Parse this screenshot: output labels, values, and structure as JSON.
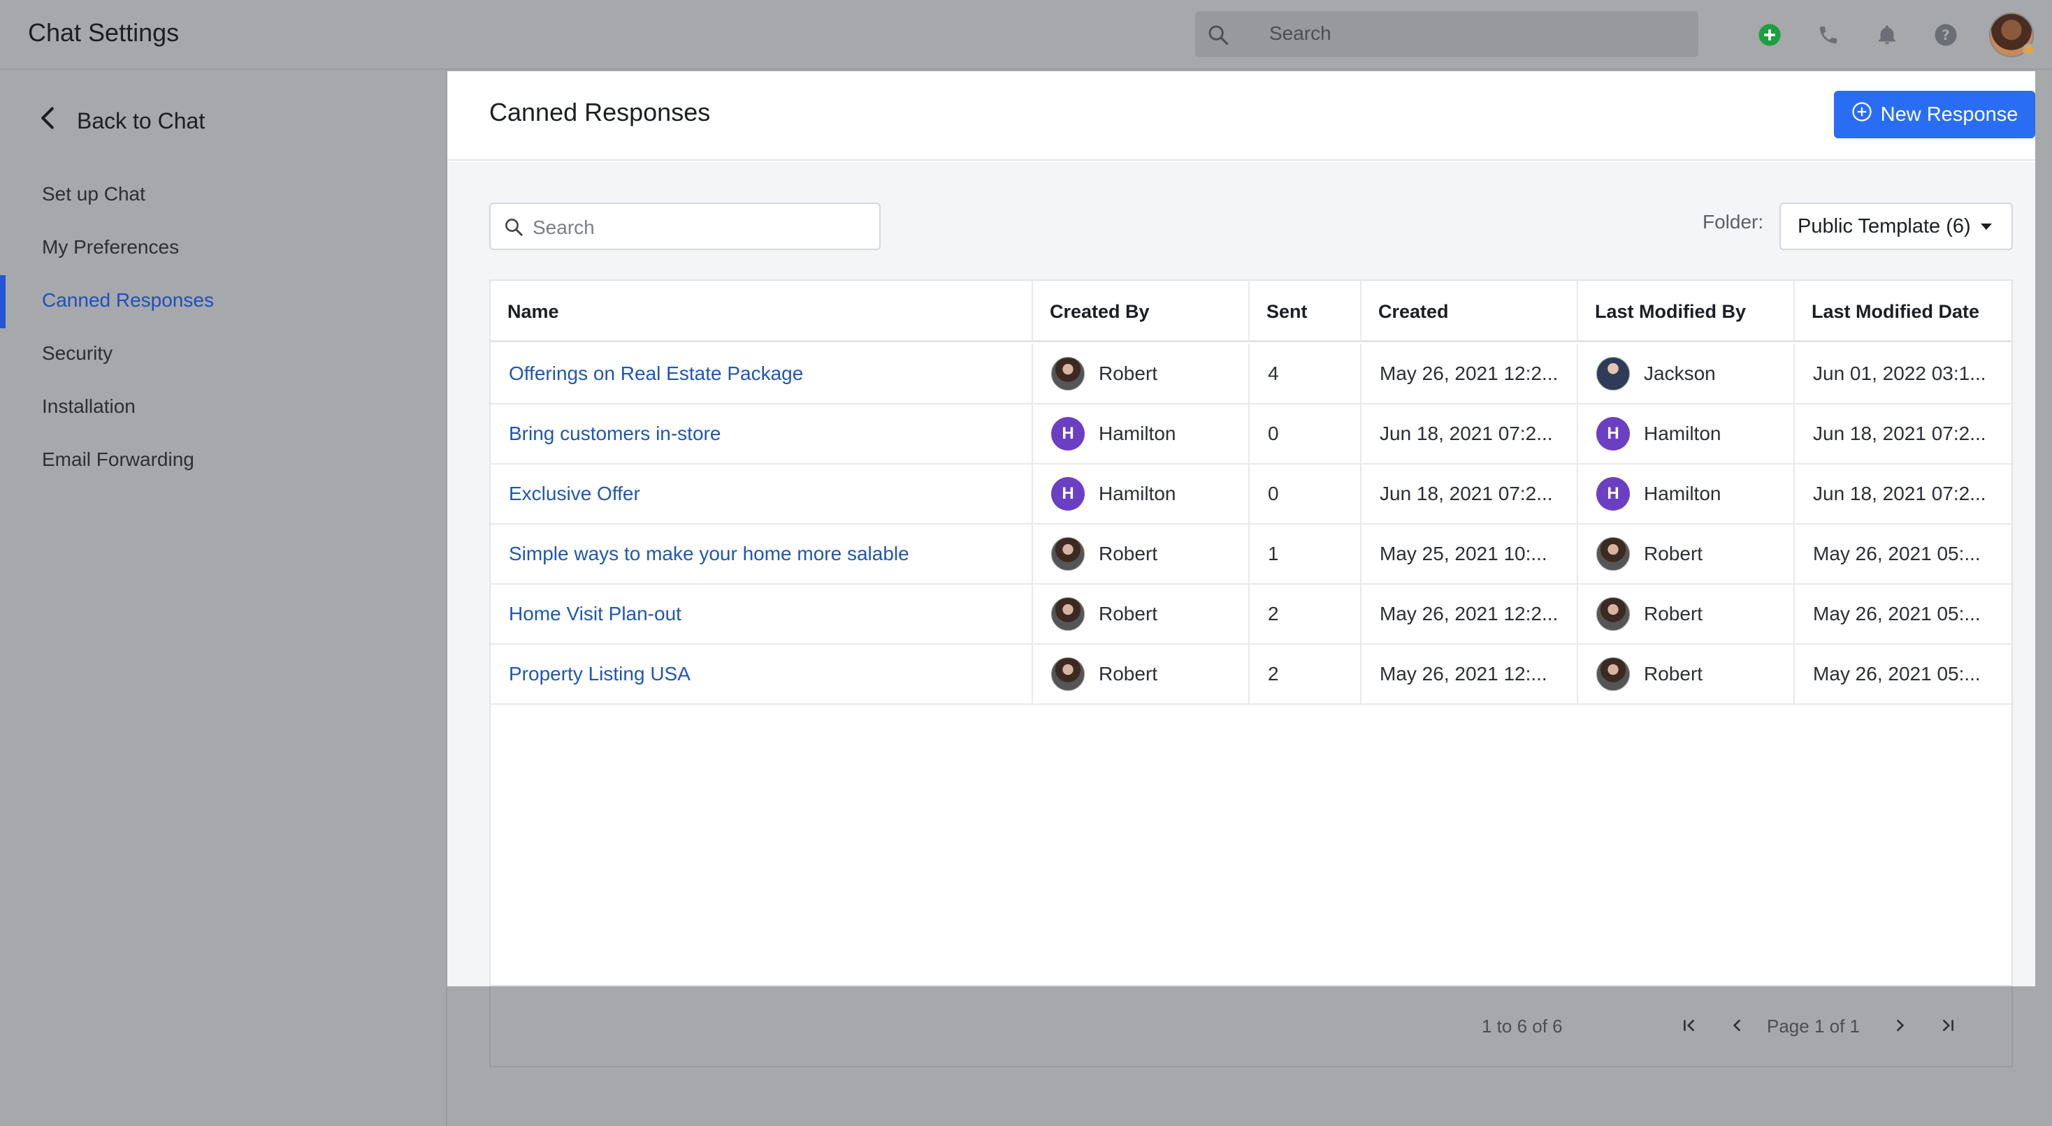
{
  "header": {
    "title": "Chat Settings",
    "search_placeholder": "Search",
    "icons": [
      "add-circle-icon",
      "phone-icon",
      "bell-icon",
      "help-icon"
    ]
  },
  "sidebar": {
    "back_label": "Back to Chat",
    "items": [
      {
        "label": "Set up Chat",
        "active": false
      },
      {
        "label": "My Preferences",
        "active": false
      },
      {
        "label": "Canned Responses",
        "active": true
      },
      {
        "label": "Security",
        "active": false
      },
      {
        "label": "Installation",
        "active": false
      },
      {
        "label": "Email Forwarding",
        "active": false
      }
    ]
  },
  "main": {
    "title": "Canned Responses",
    "new_button_label": "New Response",
    "search_placeholder": "Search",
    "folder_label": "Folder:",
    "folder_value": "Public Template (6)",
    "columns": [
      "Name",
      "Created By",
      "Sent",
      "Created",
      "Last Modified By",
      "Last Modified Date"
    ],
    "rows": [
      {
        "name": "Offerings on Real Estate Package",
        "created_by": "Robert",
        "created_by_avatar": "photo",
        "sent": "4",
        "created": "May 26, 2021 12:2...",
        "modified_by": "Jackson",
        "modified_by_avatar": "suit",
        "modified_date": "Jun 01, 2022 03:1..."
      },
      {
        "name": "Bring customers in-store",
        "created_by": "Hamilton",
        "created_by_avatar": "H",
        "sent": "0",
        "created": "Jun 18, 2021 07:2...",
        "modified_by": "Hamilton",
        "modified_by_avatar": "H",
        "modified_date": "Jun 18, 2021 07:2..."
      },
      {
        "name": "Exclusive Offer",
        "created_by": "Hamilton",
        "created_by_avatar": "H",
        "sent": "0",
        "created": "Jun 18, 2021 07:2...",
        "modified_by": "Hamilton",
        "modified_by_avatar": "H",
        "modified_date": "Jun 18, 2021 07:2..."
      },
      {
        "name": "Simple ways to make your home more salable",
        "created_by": "Robert",
        "created_by_avatar": "photo",
        "sent": "1",
        "created": "May 25, 2021 10:...",
        "modified_by": "Robert",
        "modified_by_avatar": "photo",
        "modified_date": "May 26, 2021 05:..."
      },
      {
        "name": "Home Visit Plan-out",
        "created_by": "Robert",
        "created_by_avatar": "photo",
        "sent": "2",
        "created": "May 26, 2021 12:2...",
        "modified_by": "Robert",
        "modified_by_avatar": "photo",
        "modified_date": "May 26, 2021 05:..."
      },
      {
        "name": "Property Listing USA",
        "created_by": "Robert",
        "created_by_avatar": "photo",
        "sent": "2",
        "created": "May 26, 2021 12:...",
        "modified_by": "Robert",
        "modified_by_avatar": "photo",
        "modified_date": "May 26, 2021 05:..."
      }
    ]
  },
  "footer": {
    "range": "1 to 6 of 6",
    "page": "Page 1 of 1"
  },
  "colors": {
    "accent": "#2a6df5",
    "link": "#1f56b5",
    "avatar_letter_bg": "#6b3fc4",
    "add_icon": "#1e9e3e"
  }
}
